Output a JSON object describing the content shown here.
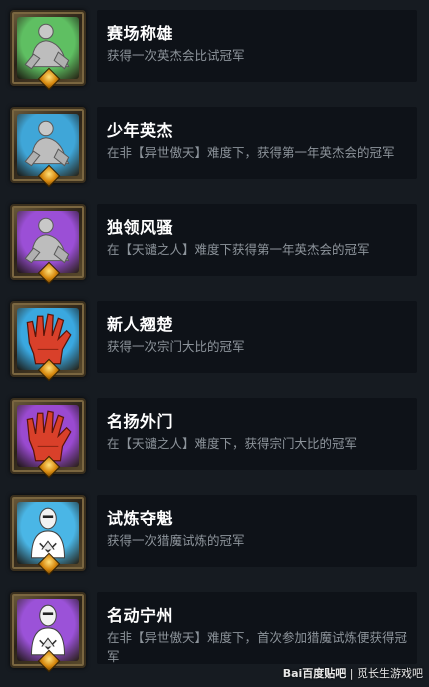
{
  "achievements": [
    {
      "title": "赛场称雄",
      "desc": "获得一次英杰会比试冠军",
      "bg": "#5fbf62",
      "figure": "sitting-figure-icon"
    },
    {
      "title": "少年英杰",
      "desc": "在非【异世傲天】难度下，获得第一年英杰会的冠军",
      "bg": "#3fa6d8",
      "figure": "sitting-figure-icon"
    },
    {
      "title": "独领风骚",
      "desc": "在【天谴之人】难度下获得第一年英杰会的冠军",
      "bg": "#9b4fd6",
      "figure": "sitting-figure-icon"
    },
    {
      "title": "新人翘楚",
      "desc": "获得一次宗门大比的冠军",
      "bg": "#3aa8e0",
      "figure": "red-hand-icon"
    },
    {
      "title": "名扬外门",
      "desc": "在【天谴之人】难度下，获得宗门大比的冠军",
      "bg": "#9a4ad0",
      "figure": "red-hand-icon"
    },
    {
      "title": "试炼夺魁",
      "desc": "获得一次猎魔试炼的冠军",
      "bg": "#4ab6e6",
      "figure": "masked-fighter-icon"
    },
    {
      "title": "名动宁州",
      "desc": "在非【异世傲天】难度下，首次参加猎魔试炼便获得冠军",
      "bg": "#9b52d8",
      "figure": "masked-fighter-icon"
    }
  ],
  "watermark": {
    "brand": "Bai百度贴吧",
    "separator": "|",
    "author": "觅长生游戏吧"
  }
}
